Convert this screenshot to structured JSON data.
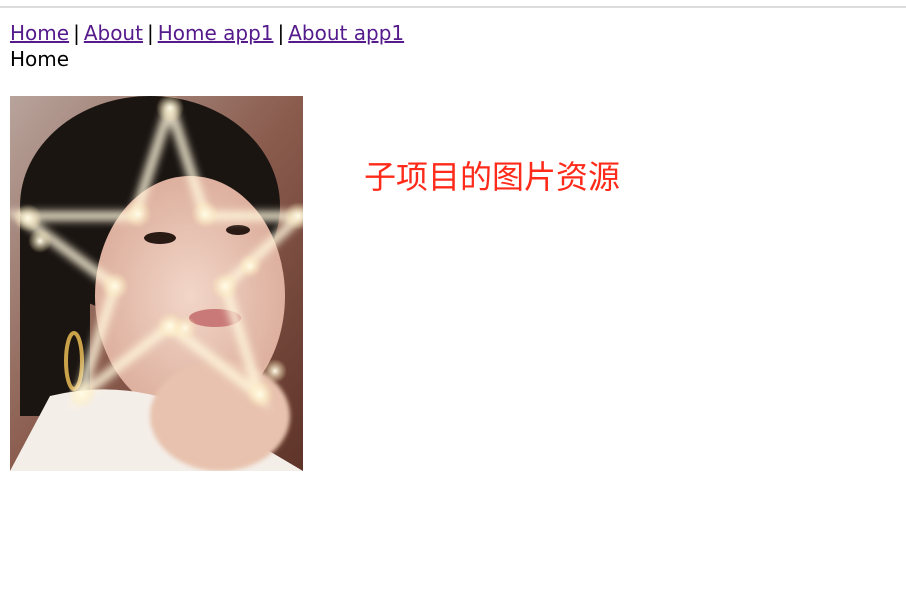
{
  "nav": {
    "links": [
      {
        "label": "Home"
      },
      {
        "label": "About"
      },
      {
        "label": "Home app1"
      },
      {
        "label": "About app1"
      }
    ],
    "separator": "|",
    "link_color": "#551a8b"
  },
  "page": {
    "heading": "Home"
  },
  "image": {
    "description_icon": "photo-woman-star-lights"
  },
  "caption": {
    "text": "子项目的图片资源",
    "color": "#ff2a1a"
  }
}
